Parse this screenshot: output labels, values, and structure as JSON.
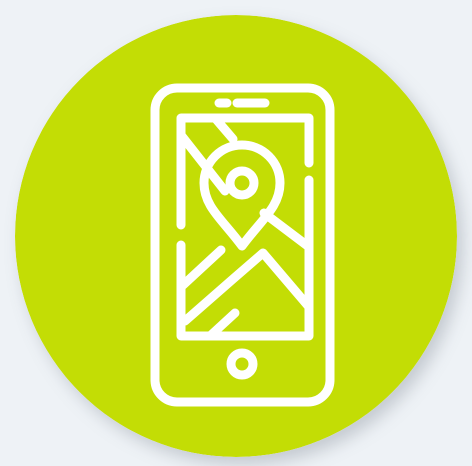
{
  "icon": {
    "name": "mobile-map-location-icon",
    "badge_color": "#c3dd05",
    "stroke_color": "#ffffff",
    "page_background": "#eef2f6"
  }
}
